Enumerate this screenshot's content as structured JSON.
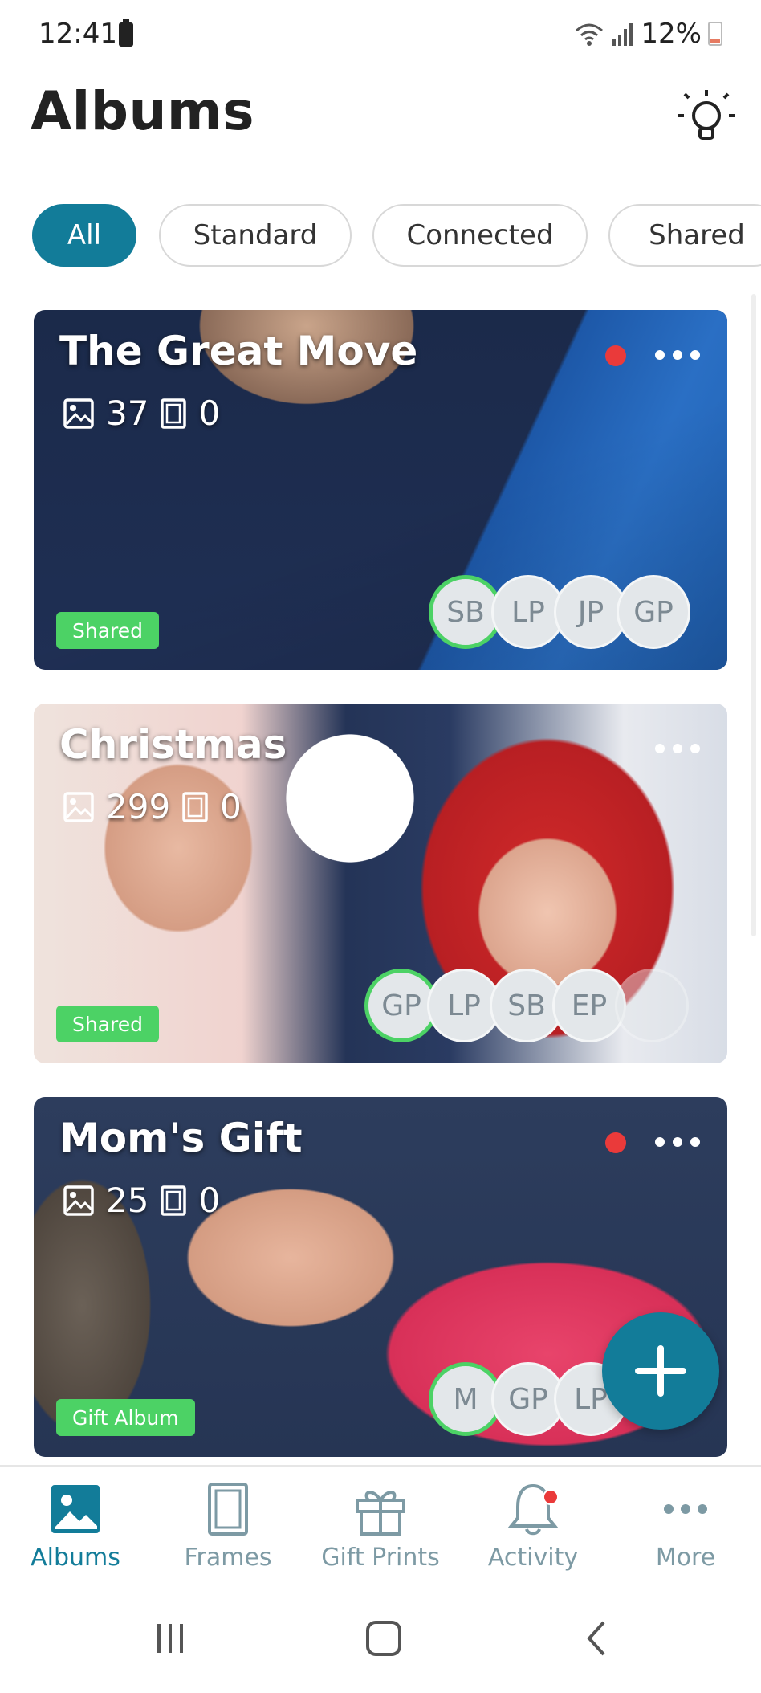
{
  "status": {
    "time": "12:41",
    "battery": "12%"
  },
  "header": {
    "title": "Albums"
  },
  "filters": [
    "All",
    "Standard",
    "Connected",
    "Shared"
  ],
  "albums": [
    {
      "title": "The Great Move",
      "photos": "37",
      "frames": "0",
      "badge": "Shared",
      "unread": true,
      "members": [
        "SB",
        "LP",
        "JP",
        "GP"
      ]
    },
    {
      "title": "Christmas",
      "photos": "299",
      "frames": "0",
      "badge": "Shared",
      "unread": false,
      "members": [
        "GP",
        "LP",
        "SB",
        "EP"
      ]
    },
    {
      "title": "Mom's Gift",
      "photos": "25",
      "frames": "0",
      "badge": "Gift Album",
      "unread": true,
      "members": [
        "M",
        "GP",
        "LP"
      ]
    }
  ],
  "nav": {
    "items": [
      {
        "label": "Albums",
        "icon": "image-icon"
      },
      {
        "label": "Frames",
        "icon": "frame-icon"
      },
      {
        "label": "Gift Prints",
        "icon": "gift-icon"
      },
      {
        "label": "Activity",
        "icon": "bell-icon"
      },
      {
        "label": "More",
        "icon": "more-icon"
      }
    ]
  },
  "colors": {
    "accent": "#127c99",
    "badge": "#4cd265",
    "dot": "#ea3a3a"
  }
}
